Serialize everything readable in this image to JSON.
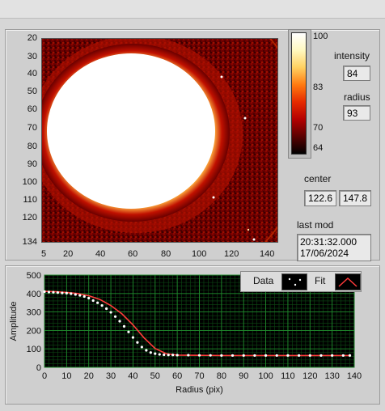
{
  "image_panel": {
    "y_ticks": [
      "20",
      "30",
      "40",
      "50",
      "60",
      "70",
      "80",
      "90",
      "100",
      "110",
      "120",
      "134"
    ],
    "x_ticks": [
      "5",
      "20",
      "40",
      "60",
      "80",
      "100",
      "120",
      "140"
    ],
    "colorbar": {
      "ticks": [
        "100",
        "83",
        "70",
        "64"
      ],
      "colors": [
        "#000000",
        "#5a0000",
        "#b40000",
        "#e62a00",
        "#ff7a10",
        "#ffd060",
        "#fff8c0",
        "#ffffff"
      ]
    },
    "intensity": {
      "label": "intensity",
      "value": "84"
    },
    "radius": {
      "label": "radius",
      "value": "93"
    },
    "center": {
      "label": "center",
      "x": "122.6",
      "y": "147.8"
    },
    "last_mod": {
      "label": "last mod",
      "time": "20:31:32.000",
      "date": "17/06/2024"
    }
  },
  "chart_data": {
    "type": "scatter",
    "title": "",
    "xlabel": "Radius (pix)",
    "ylabel": "Amplitude",
    "xlim": [
      0,
      140
    ],
    "ylim": [
      0,
      500
    ],
    "x_ticks": [
      0,
      10,
      20,
      30,
      40,
      50,
      60,
      70,
      80,
      90,
      100,
      110,
      120,
      130,
      140
    ],
    "y_ticks": [
      0,
      100,
      200,
      300,
      400,
      500
    ],
    "legend": {
      "placement": "top-right",
      "data_label": "Data",
      "fit_label": "Fit"
    },
    "grid": true,
    "series": [
      {
        "name": "Data",
        "kind": "points",
        "color": "#ffffff",
        "x": [
          0,
          2,
          4,
          6,
          8,
          10,
          12,
          14,
          16,
          18,
          20,
          22,
          24,
          26,
          28,
          30,
          32,
          34,
          36,
          38,
          40,
          42,
          44,
          46,
          48,
          50,
          52,
          54,
          56,
          58,
          60,
          65,
          70,
          75,
          80,
          85,
          90,
          95,
          100,
          105,
          110,
          115,
          120,
          125,
          130,
          135,
          138
        ],
        "y": [
          410,
          408,
          407,
          405,
          403,
          402,
          399,
          395,
          390,
          384,
          375,
          362,
          350,
          335,
          318,
          298,
          275,
          250,
          222,
          192,
          162,
          135,
          110,
          92,
          80,
          74,
          70,
          68,
          67,
          67,
          66,
          66,
          65,
          65,
          64,
          64,
          64,
          64,
          64,
          64,
          64,
          64,
          64,
          64,
          64,
          64,
          64
        ]
      },
      {
        "name": "Fit",
        "kind": "line",
        "color": "#ff3a3a",
        "x": [
          0,
          5,
          10,
          15,
          20,
          25,
          30,
          35,
          40,
          45,
          50,
          55,
          60,
          70,
          80,
          90,
          100,
          110,
          120,
          130,
          138
        ],
        "y": [
          412,
          410,
          406,
          400,
          388,
          368,
          335,
          290,
          230,
          160,
          102,
          74,
          66,
          65,
          64,
          64,
          64,
          64,
          64,
          64,
          64
        ]
      }
    ]
  }
}
